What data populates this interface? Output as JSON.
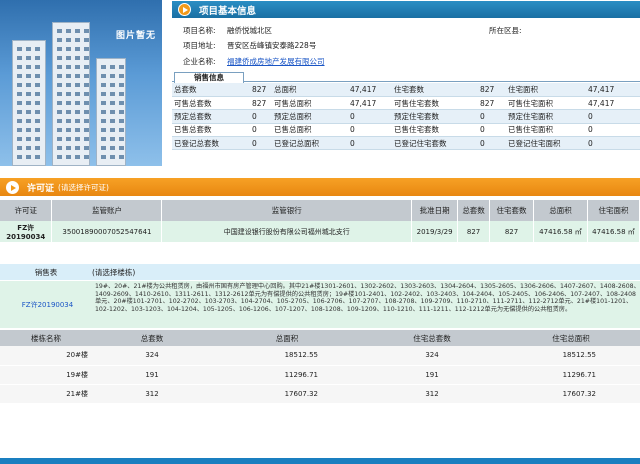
{
  "photo": {
    "label": "图片暂无"
  },
  "basic_info": {
    "title": "项目基本信息",
    "rows": [
      {
        "label": "项目名称:",
        "value": "融侨悦城北区",
        "label2": "所在区县:",
        "value2": ""
      },
      {
        "label": "项目地址:",
        "value": "晋安区岳峰镇安泰路228号"
      },
      {
        "label": "企业名称:",
        "value": "福建侨成房地产发展有限公司"
      }
    ],
    "tab": "销售信息",
    "sales": [
      [
        "总套数",
        "827",
        "总面积",
        "47,417",
        "住宅套数",
        "827",
        "住宅面积",
        "47,417"
      ],
      [
        "可售总套数",
        "827",
        "可售总面积",
        "47,417",
        "可售住宅套数",
        "827",
        "可售住宅面积",
        "47,417"
      ],
      [
        "预定总套数",
        "0",
        "预定总面积",
        "0",
        "预定住宅套数",
        "0",
        "预定住宅面积",
        "0"
      ],
      [
        "已售总套数",
        "0",
        "已售总面积",
        "0",
        "已售住宅套数",
        "0",
        "已售住宅面积",
        "0"
      ],
      [
        "已登记总套数",
        "0",
        "已登记总面积",
        "0",
        "已登记住宅套数",
        "0",
        "已登记住宅面积",
        "0"
      ]
    ]
  },
  "permit": {
    "title": "许可证",
    "subtitle": "(请选择许可证)",
    "headers": [
      "许可证",
      "监管账户",
      "监管银行",
      "批准日期",
      "总套数",
      "住宅套数",
      "总面积",
      "住宅面积"
    ],
    "row": [
      "FZ许20190034",
      "35001890007052547641",
      "中国建设银行股份有限公司福州城北支行",
      "2019/3/29",
      "827",
      "827",
      "47416.58 ㎡",
      "47416.58 ㎡"
    ]
  },
  "sales_table": {
    "title": "销售表",
    "subtitle": "(请选择楼栋)",
    "permit_id": "FZ许20190034",
    "description": "19#、20#、21#楼为公共租赁房，由福州市国有房产管理中心回购。其中21#楼1301-2601、1302-2602、1303-2603、1304-2604、1305-2605、1306-2606、1407-2607、1408-2608、1409-2609、1410-2610、1311-2611、1312-2612单元为有偿提供的公共租赁房；19#楼101-2401、102-2402、103-2403、104-2404、105-2405、106-2406、107-2407、108-2408单元、20#楼101-2701、102-2702、103-2703、104-2704、105-2705、106-2706、107-2707、108-2708、109-2709、110-2710、111-2711、112-2712单元、21#楼101-1201、102-1202、103-1203、104-1204、105-1205、106-1206、107-1207、108-1208、109-1209、110-1210、111-1211、112-1212单元为无偿提供的公共租赁房。",
    "headers": [
      "楼栋名称",
      "总套数",
      "总面积",
      "住宅总套数",
      "住宅总面积"
    ],
    "rows": [
      [
        "20#楼",
        "324",
        "18512.55",
        "324",
        "18512.55"
      ],
      [
        "19#楼",
        "191",
        "11296.71",
        "191",
        "11296.71"
      ],
      [
        "21#楼",
        "312",
        "17607.32",
        "312",
        "17607.32"
      ]
    ]
  }
}
